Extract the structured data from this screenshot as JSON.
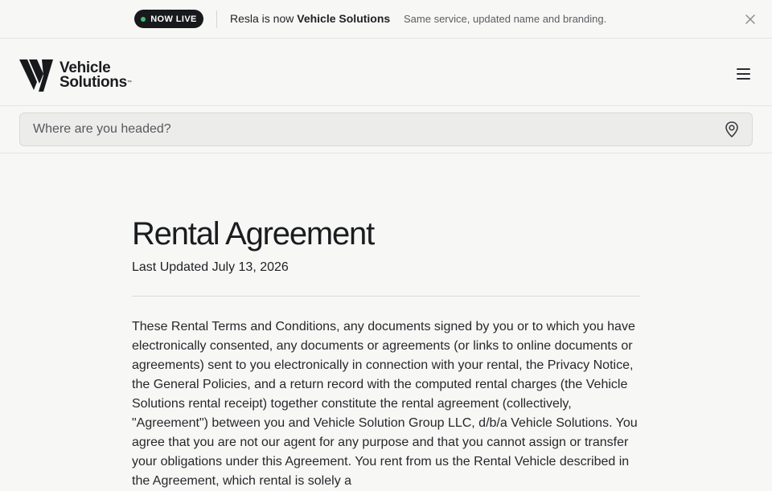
{
  "announcement": {
    "badge": "NOW LIVE",
    "headline_prefix": "Resla is now ",
    "headline_bold": "Vehicle Solutions",
    "subtext": "Same service, updated name and branding."
  },
  "brand": {
    "line1": "Vehicle",
    "line2": "Solutions",
    "tm": "™"
  },
  "search": {
    "placeholder": "Where are you headed?"
  },
  "page": {
    "title": "Rental Agreement",
    "last_updated": "Last Updated July 13, 2026",
    "body": "These Rental Terms and Conditions, any documents signed by you or to which you have electronically consented, any documents or agreements (or links to online documents or agreements) sent to you electronically in connection with your rental, the Privacy Notice, the General Policies, and a return record with the computed rental charges (the Vehicle Solutions rental receipt) together constitute the rental agreement (collectively, \"Agreement\") between you and Vehicle Solution Group LLC, d/b/a Vehicle Solutions. You agree that you are not our agent for any purpose and that you cannot assign or transfer your obligations under this Agreement. You rent from us the Rental Vehicle described in the Agreement, which rental is solely a"
  },
  "colors": {
    "badge_bg": "#17191c",
    "live_dot": "#3ec07a",
    "background": "#f7f7f5"
  },
  "icons": {
    "close": "close-icon",
    "menu": "hamburger-menu-icon",
    "location": "location-pin-icon"
  }
}
